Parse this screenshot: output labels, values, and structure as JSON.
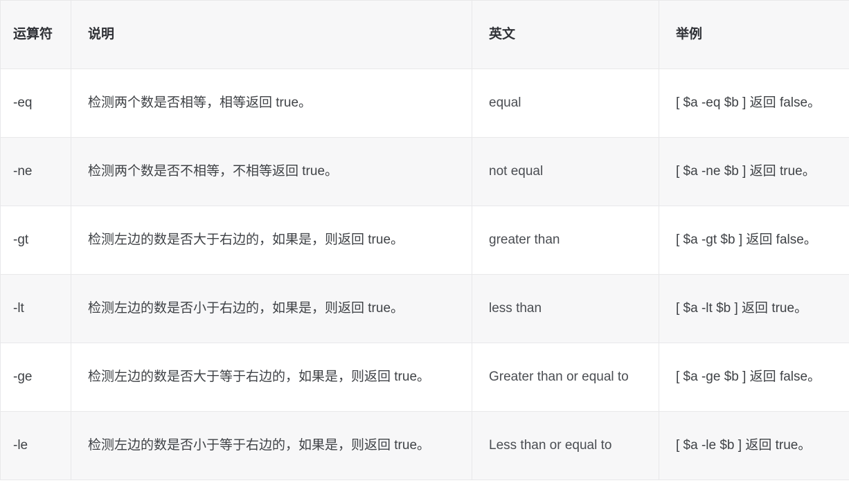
{
  "table": {
    "columns": [
      {
        "key": "operator",
        "label": "运算符"
      },
      {
        "key": "description",
        "label": "说明"
      },
      {
        "key": "english",
        "label": "英文"
      },
      {
        "key": "example",
        "label": "举例"
      }
    ],
    "rows": [
      {
        "operator": "-eq",
        "description": "检测两个数是否相等，相等返回 true。",
        "english": "equal",
        "example": "[ $a -eq $b ] 返回 false。"
      },
      {
        "operator": "-ne",
        "description": "检测两个数是否不相等，不相等返回 true。",
        "english": "not equal",
        "example": "[ $a -ne $b ] 返回 true。"
      },
      {
        "operator": "-gt",
        "description": "检测左边的数是否大于右边的，如果是，则返回 true。",
        "english": "greater than",
        "example": "[ $a -gt $b ] 返回 false。"
      },
      {
        "operator": "-lt",
        "description": "检测左边的数是否小于右边的，如果是，则返回 true。",
        "english": "less than",
        "example": "[ $a -lt $b ] 返回 true。"
      },
      {
        "operator": "-ge",
        "description": "检测左边的数是否大于等于右边的，如果是，则返回 true。",
        "english": "Greater than or equal to",
        "example": "[ $a -ge $b ] 返回 false。"
      },
      {
        "operator": "-le",
        "description": "检测左边的数是否小于等于右边的，如果是，则返回 true。",
        "english": "Less than or equal to",
        "example": "[ $a -le $b ] 返回 true。"
      }
    ]
  },
  "colors": {
    "header_background": "#f7f7f8",
    "stripe_background": "#f7f7f8",
    "row_background": "#ffffff",
    "border": "#e8e8ea",
    "header_text": "#2f3136",
    "body_text": "#3f4246"
  }
}
